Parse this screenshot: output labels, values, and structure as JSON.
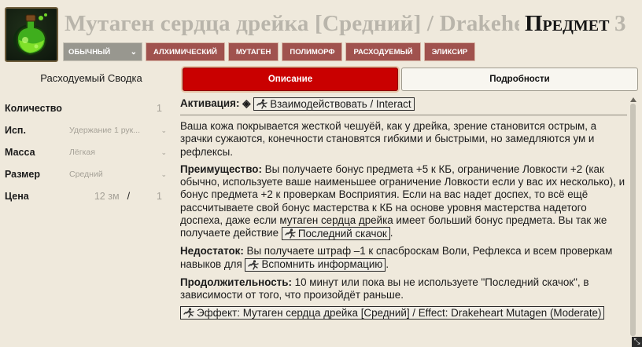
{
  "header": {
    "title": "Мутаген сердца дрейка [Средний] / Drakeheart Mutagen (Moderate)",
    "type_label": "Предмет",
    "level": "3",
    "rarity": "ОБЫЧНЫЙ",
    "traits": [
      "АЛХИМИЧЕСКИЙ",
      "МУТАГЕН",
      "ПОЛИМОРФ",
      "РАСХОДУЕМЫЙ",
      "ЭЛИКСИР"
    ]
  },
  "sidebar": {
    "title": "Расходуемый Сводка",
    "properties": {
      "quantity": {
        "label": "Количество",
        "value": "1"
      },
      "usage": {
        "label": "Исп.",
        "value": "Удержание 1 рук..."
      },
      "bulk": {
        "label": "Масса",
        "value": "Лёгкая"
      },
      "size": {
        "label": "Размер",
        "value": "Средний"
      },
      "price": {
        "label": "Цена",
        "value": "12 зм",
        "sep": "/",
        "per": "1"
      }
    }
  },
  "tabs": {
    "description": "Описание",
    "details": "Подробности"
  },
  "description": {
    "activation_label": "Активация:",
    "activation_glyph": "◈",
    "activation_action": "Взаимодействовать / Interact",
    "intro": "Ваша кожа покрывается жесткой чешуёй, как у дрейка, зрение становится острым, а зрачки сужаются, конечности становятся гибкими и быстрыми, но замедляются ум и рефлексы.",
    "benefit_label": "Преимущество:",
    "benefit_text": "Вы получаете бонус предмета +5 к КБ, ограничение Ловкости +2 (как обычно, используете ваше наименьшее ограничение Ловкости если у вас их несколько), и бонус предмета +2 к проверкам Восприятия. Если на вас надет доспех, то всё ещё рассчитываете свой бонус мастерства к КБ на основе уровня мастерства надетого доспеха, даже если мутаген сердца дрейка имеет больший бонус предмета. Вы так же получаете действие",
    "benefit_action": "Последний скачок",
    "benefit_end": ".",
    "drawback_label": "Недостаток:",
    "drawback_text": "Вы получаете штраф –1 к спасброскам Воли, Рефлекса и всем проверкам навыков для",
    "drawback_action": "Вспомнить информацию",
    "drawback_end": ".",
    "duration_label": "Продолжительность:",
    "duration_text": "10 минут или пока вы не используете \"Последний скачок\", в зависимости от того, что произойдёт раньше.",
    "effect_link": "Эффект: Мутаген сердца дрейка [Средний] / Effect: Drakeheart Mutagen (Moderate)"
  },
  "colors": {
    "active_tab": "#c90000",
    "trait_bg": "#a0524e",
    "rarity_bg": "#98978f",
    "background": "#efe9dc"
  },
  "icons": {
    "item": "green-potion-flask-icon",
    "action": "running-man-icon",
    "scroll": "scroll-up-arrow-icon",
    "resize": "resize-icon"
  }
}
